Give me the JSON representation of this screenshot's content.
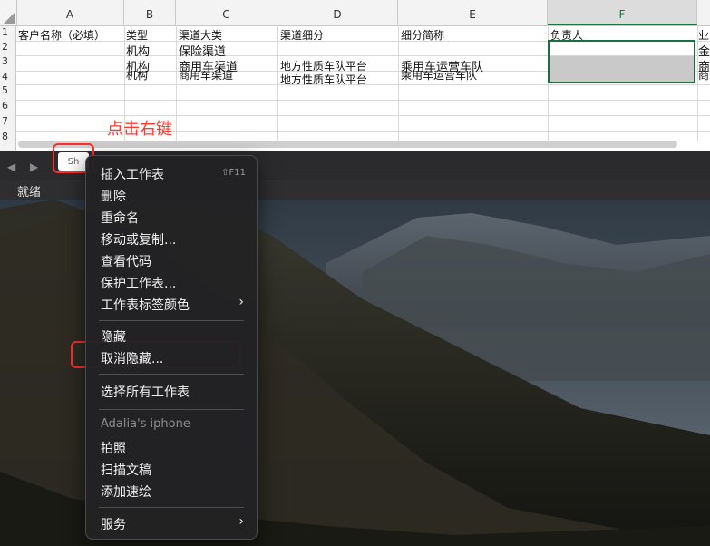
{
  "spreadsheet": {
    "columns": [
      {
        "letter": "A"
      },
      {
        "letter": "B"
      },
      {
        "letter": "C"
      },
      {
        "letter": "D"
      },
      {
        "letter": "E"
      },
      {
        "letter": "F"
      }
    ],
    "row_numbers": [
      "1",
      "2",
      "3",
      "4",
      "5",
      "6",
      "7",
      "8"
    ],
    "headers": {
      "a": "客户名称（必填）",
      "b": "类型",
      "c": "渠道大类",
      "d": "渠道细分",
      "e": "细分简称",
      "f": "负责人",
      "g": "业"
    },
    "row2": {
      "b": "机构",
      "c": "保险渠道",
      "g": "金"
    },
    "row3": {
      "b": "机构",
      "c": "商用车渠道",
      "d": "地方性质车队平台",
      "e": "乘用车运营车队",
      "g": "商"
    },
    "row4": {
      "b": "机构",
      "c": "商用车渠道",
      "d": "地方性质车队平台",
      "e": "乘用车运营车队",
      "g": "商"
    }
  },
  "tabbar": {
    "prev_arrow": "◀",
    "next_arrow": "▶",
    "sheet_tab_label": "Sh"
  },
  "status": {
    "text": "就绪"
  },
  "annotation": {
    "label": "点击右键"
  },
  "menu": {
    "items": [
      {
        "label": "插入工作表",
        "shortcut": "⇧F11"
      },
      {
        "label": "删除"
      },
      {
        "label": "重命名"
      },
      {
        "label": "移动或复制..."
      },
      {
        "label": "查看代码"
      },
      {
        "label": "保护工作表..."
      },
      {
        "label": "工作表标签颜色",
        "submenu": "›"
      },
      {
        "label": "隐藏"
      },
      {
        "label": "取消隐藏..."
      },
      {
        "label": "选择所有工作表"
      },
      {
        "label": "Adalia's iphone"
      },
      {
        "label": "拍照"
      },
      {
        "label": "扫描文稿"
      },
      {
        "label": "添加速绘"
      },
      {
        "label": "服务",
        "submenu": "›"
      }
    ]
  },
  "colors": {
    "accent_green": "#107c41",
    "highlight_red": "#ff2d2d",
    "annotation_red": "#ff3b30"
  }
}
